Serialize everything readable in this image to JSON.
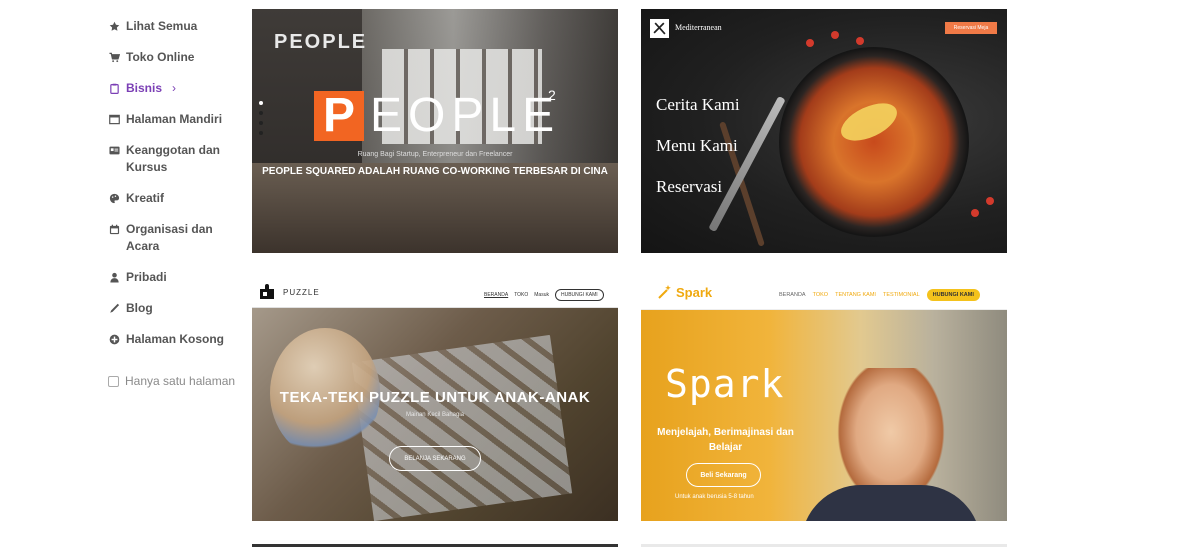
{
  "sidebar": {
    "items": [
      {
        "label": "Lihat Semua",
        "icon": "star-icon"
      },
      {
        "label": "Toko Online",
        "icon": "cart-icon"
      },
      {
        "label": "Bisnis",
        "icon": "clipboard-icon",
        "active": true,
        "chevron": "›"
      },
      {
        "label": "Halaman Mandiri",
        "icon": "window-icon"
      },
      {
        "label": "Keanggotan dan Kursus",
        "icon": "id-card-icon"
      },
      {
        "label": "Kreatif",
        "icon": "palette-icon"
      },
      {
        "label": "Organisasi dan Acara",
        "icon": "calendar-icon"
      },
      {
        "label": "Pribadi",
        "icon": "person-icon"
      },
      {
        "label": "Blog",
        "icon": "pen-icon"
      },
      {
        "label": "Halaman Kosong",
        "icon": "plus-circle-icon"
      }
    ],
    "checkbox_label": "Hanya satu halaman",
    "active_color": "#7b3fb5"
  },
  "cards": {
    "people": {
      "sign": "PEOPLE",
      "logo_p": "P",
      "logo_rest": "EOPLE",
      "logo_sup": "2",
      "small_text": "Ruang Bagi Startup, Enterpreneur dan Freelancer",
      "tagline": "PEOPLE SQUARED ADALAH RUANG CO-WORKING TERBESAR DI CINA",
      "accent": "#f26522"
    },
    "mediterranean": {
      "brand": "Mediterranean",
      "button": "Reservasi Meja",
      "menu": [
        "Cerita Kami",
        "Menu Kami",
        "Reservasi"
      ],
      "accent": "#f07a47"
    },
    "puzzle": {
      "brand": "PUZZLE",
      "nav": [
        "BERANDA",
        "TOKO",
        "Masuk"
      ],
      "nav_button": "HUBUNGI KAMI",
      "title": "TEKA-TEKI PUZZLE UNTUK ANAK-ANAK",
      "subtitle": "Mainan Kecil Bahagia",
      "button": "BELANJA SEKARANG"
    },
    "spark": {
      "brand": "Spark",
      "nav": [
        "BERANDA",
        "TOKO",
        "TENTANG KAMI",
        "TESTIMONIAL"
      ],
      "nav_button": "HUBUNGI KAMI",
      "title": "Spark",
      "subtitle": "Menjelajah, Berimajinasi dan Belajar",
      "button": "Beli Sekarang",
      "small_text": "Untuk anak berusia 5-8 tahun",
      "accent": "#f0a90f"
    }
  }
}
